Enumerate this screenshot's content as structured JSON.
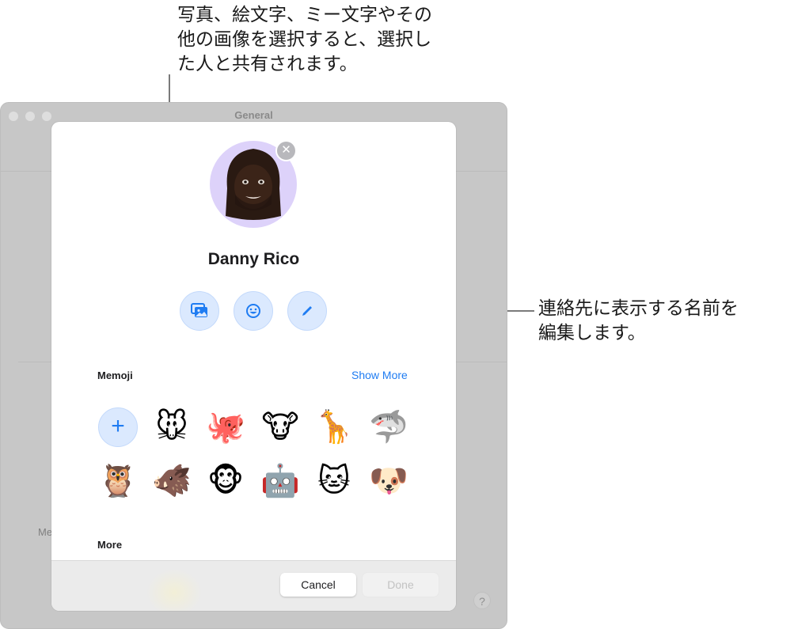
{
  "callouts": {
    "top": "写真、絵文字、ミー文字やその\n他の画像を選択すると、選択し\nた人と共有されます。",
    "right": "連絡先に表示する名前を\n編集します。"
  },
  "background_window": {
    "title": "General",
    "partial_label": "Me",
    "help_label": "?"
  },
  "sheet": {
    "avatar_icon": "memoji-avatar",
    "remove_label": "✕",
    "contact_name": "Danny Rico",
    "actions": [
      {
        "name": "photos",
        "icon": "photos-icon"
      },
      {
        "name": "emoji",
        "icon": "emoji-icon"
      },
      {
        "name": "edit-name",
        "icon": "pencil-icon"
      }
    ],
    "memoji_section": {
      "title": "Memoji",
      "show_more": "Show More",
      "add_label": "+",
      "items": [
        {
          "name": "mouse",
          "glyph": "🐭"
        },
        {
          "name": "octopus",
          "glyph": "🐙"
        },
        {
          "name": "cow",
          "glyph": "🐮"
        },
        {
          "name": "giraffe",
          "glyph": "🦒"
        },
        {
          "name": "shark",
          "glyph": "🦈"
        },
        {
          "name": "owl",
          "glyph": "🦉"
        },
        {
          "name": "boar",
          "glyph": "🐗"
        },
        {
          "name": "monkey",
          "glyph": "🐵"
        },
        {
          "name": "robot",
          "glyph": "🤖"
        },
        {
          "name": "cat",
          "glyph": "🐱"
        },
        {
          "name": "dog",
          "glyph": "🐶"
        }
      ]
    },
    "more_section": {
      "title": "More"
    },
    "footer": {
      "cancel": "Cancel",
      "done": "Done"
    }
  }
}
